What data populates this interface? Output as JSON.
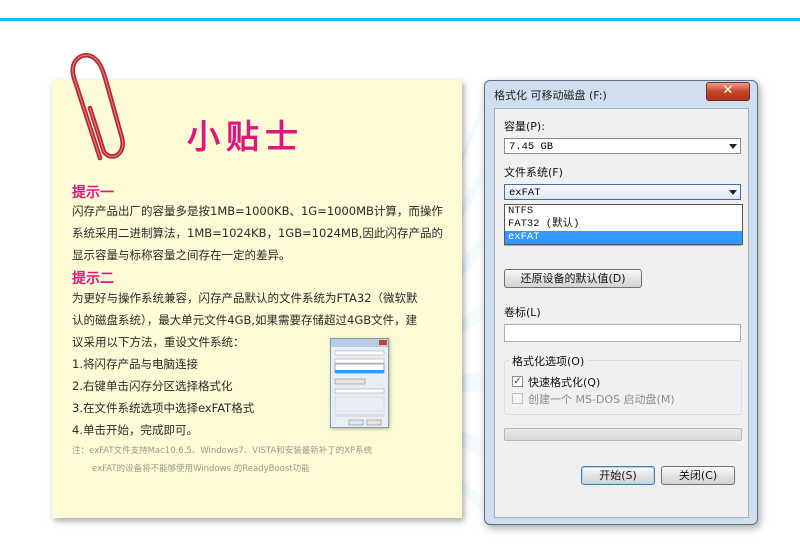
{
  "note": {
    "title": "小贴士",
    "tip1_heading": "提示一",
    "tip1_lines": [
      "闪存产品出厂的容量多是按1MB=1000KB、1G=1000MB计算，而操作",
      "系统采用二进制算法，1MB=1024KB，1GB=1024MB,因此闪存产品的",
      "显示容量与标称容量之间存在一定的差异。"
    ],
    "tip2_heading": "提示二",
    "tip2_lines": [
      "为更好与操作系统兼容，闪存产品默认的文件系统为FTA32（微软默",
      "认的磁盘系统），最大单元文件4GB,如果需要存储超过4GB文件，建",
      "议采用以下方法，重设文件系统："
    ],
    "steps": [
      "1.将闪存产品与电脑连接",
      "2.右键单击闪存分区选择格式化",
      "3.在文件系统选项中选择exFAT格式",
      "4.单击开始，完成即可。"
    ],
    "footnote_lines": [
      "注：exFAT文件支持Mac10.6.5、Windows7、VISTA和安装最新补丁的XP系统",
      "exFAT的设备将不能够使用Windows 的ReadyBoost功能"
    ]
  },
  "dialog": {
    "title": "格式化 可移动磁盘 (F:)",
    "close_label": "✕",
    "capacity_label": "容量(P):",
    "capacity_value": "7.45 GB",
    "filesystem_label": "文件系统(F)",
    "filesystem_value": "exFAT",
    "filesystem_options": [
      "NTFS",
      "FAT32 (默认)",
      "exFAT"
    ],
    "restore_defaults_label": "还原设备的默认值(D)",
    "volume_label": "卷标(L)",
    "volume_value": "",
    "format_options_label": "格式化选项(O)",
    "quick_format_label": "快速格式化(Q)",
    "quick_format_checked": true,
    "msdos_label": "创建一个 MS-DOS 启动盘(M)",
    "msdos_checked": false,
    "start_label": "开始(S)",
    "close_button_label": "关闭(C)"
  },
  "colors": {
    "accent_line": "#17c1e6",
    "note_title": "#e0167f",
    "note_bg": "#fdfbd6",
    "selection": "#3399ff"
  }
}
